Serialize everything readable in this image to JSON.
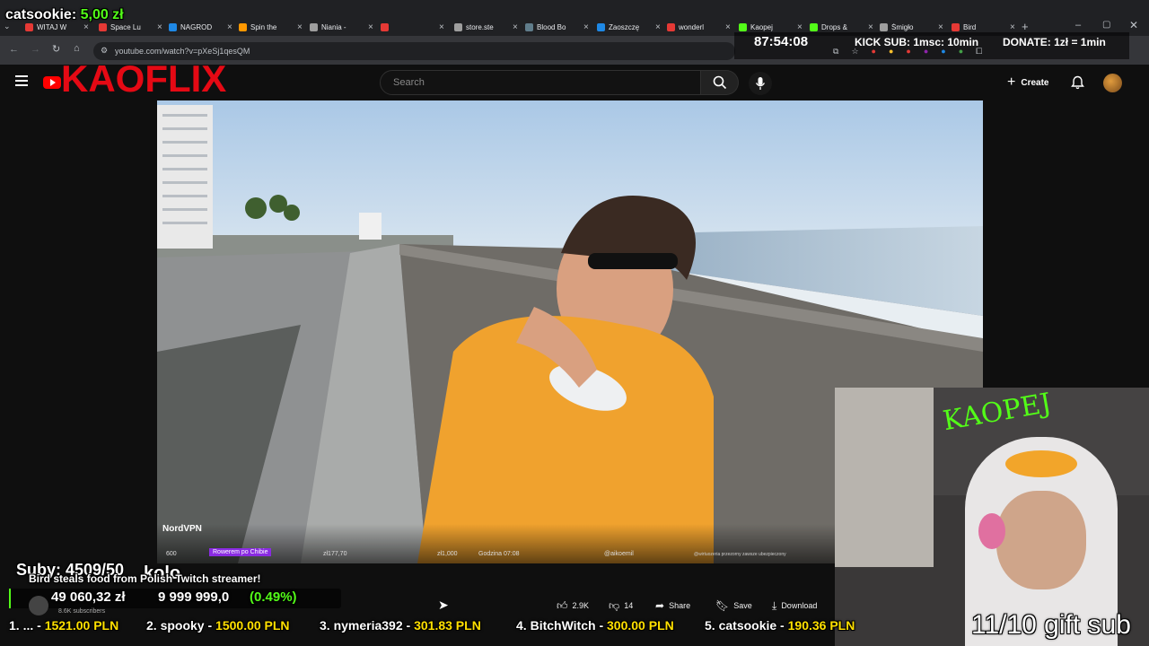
{
  "overlay_top": {
    "user": "catsookie:",
    "amount": "5,00 zł"
  },
  "tabs": [
    {
      "label": "WITAJ W",
      "color": "#e53935"
    },
    {
      "label": "Space Lu",
      "color": "#e53935"
    },
    {
      "label": "NAGROD",
      "color": "#1e88e5"
    },
    {
      "label": "Spin the",
      "color": "#ff9800"
    },
    {
      "label": "Niania -",
      "color": "#9e9e9e"
    },
    {
      "label": "",
      "color": "#e53935"
    },
    {
      "label": "store.ste",
      "color": "#9e9e9e"
    },
    {
      "label": "Blood Bo",
      "color": "#607d8b"
    },
    {
      "label": "Zaoszczę",
      "color": "#1e88e5"
    },
    {
      "label": "wonderl",
      "color": "#e53935"
    },
    {
      "label": "Kaopej",
      "color": "#53fc18"
    },
    {
      "label": "Drops &",
      "color": "#53fc18"
    },
    {
      "label": "Śmigło",
      "color": "#9e9e9e"
    },
    {
      "label": "Bird",
      "color": "#e53935"
    }
  ],
  "stream_stats": {
    "timer": "87:54:08",
    "kick_sub": "KICK SUB: 1msc: 10min",
    "donate": "DONATE: 1zł = 1min"
  },
  "address": {
    "url": "youtube.com/watch?v=pXeSj1qesQM"
  },
  "header": {
    "brand_overlay": "KAOFLIX",
    "search_placeholder": "Search",
    "create_label": "Create"
  },
  "video_bar": {
    "sponsor": "NordVPN",
    "count": "600",
    "tag": "Rowerem po Chibie",
    "value1": "zł177,70",
    "value2": "zł1,000",
    "time": "Godzina 07:08",
    "handle": "@aikoemil",
    "note": "@wirtuozeria przezorny zawsze ubezpieczony"
  },
  "bottom_overlay": {
    "subs": "Suby: 4509/50",
    "kolo": "kolo",
    "title_text": "Bird steals food from Polish Twitch streamer!",
    "balance": "49 060,32 zł",
    "target": "9 999 999,0",
    "percent": "(0.49%)",
    "subscribers": "8.6K subscribers"
  },
  "actions": {
    "likes": "2.9K",
    "dislikes": "14",
    "share": "Share",
    "save": "Save",
    "download": "Download"
  },
  "leaderboard": [
    {
      "rank": "1.",
      "name": "...",
      "amount": "1521.00 PLN"
    },
    {
      "rank": "2.",
      "name": "spooky",
      "amount": "1500.00 PLN"
    },
    {
      "rank": "3.",
      "name": "nymeria392",
      "amount": "301.83 PLN"
    },
    {
      "rank": "4.",
      "name": "BitchWitch",
      "amount": "300.00 PLN"
    },
    {
      "rank": "5.",
      "name": "catsookie",
      "amount": "190.36 PLN"
    }
  ],
  "webcam": {
    "neon_sign": "KAOPEJ",
    "gift_sub": "11/10 gift sub"
  },
  "colors": {
    "kick_green": "#53fc18",
    "youtube_red": "#ff0000",
    "leader_yellow": "#ffe000"
  }
}
